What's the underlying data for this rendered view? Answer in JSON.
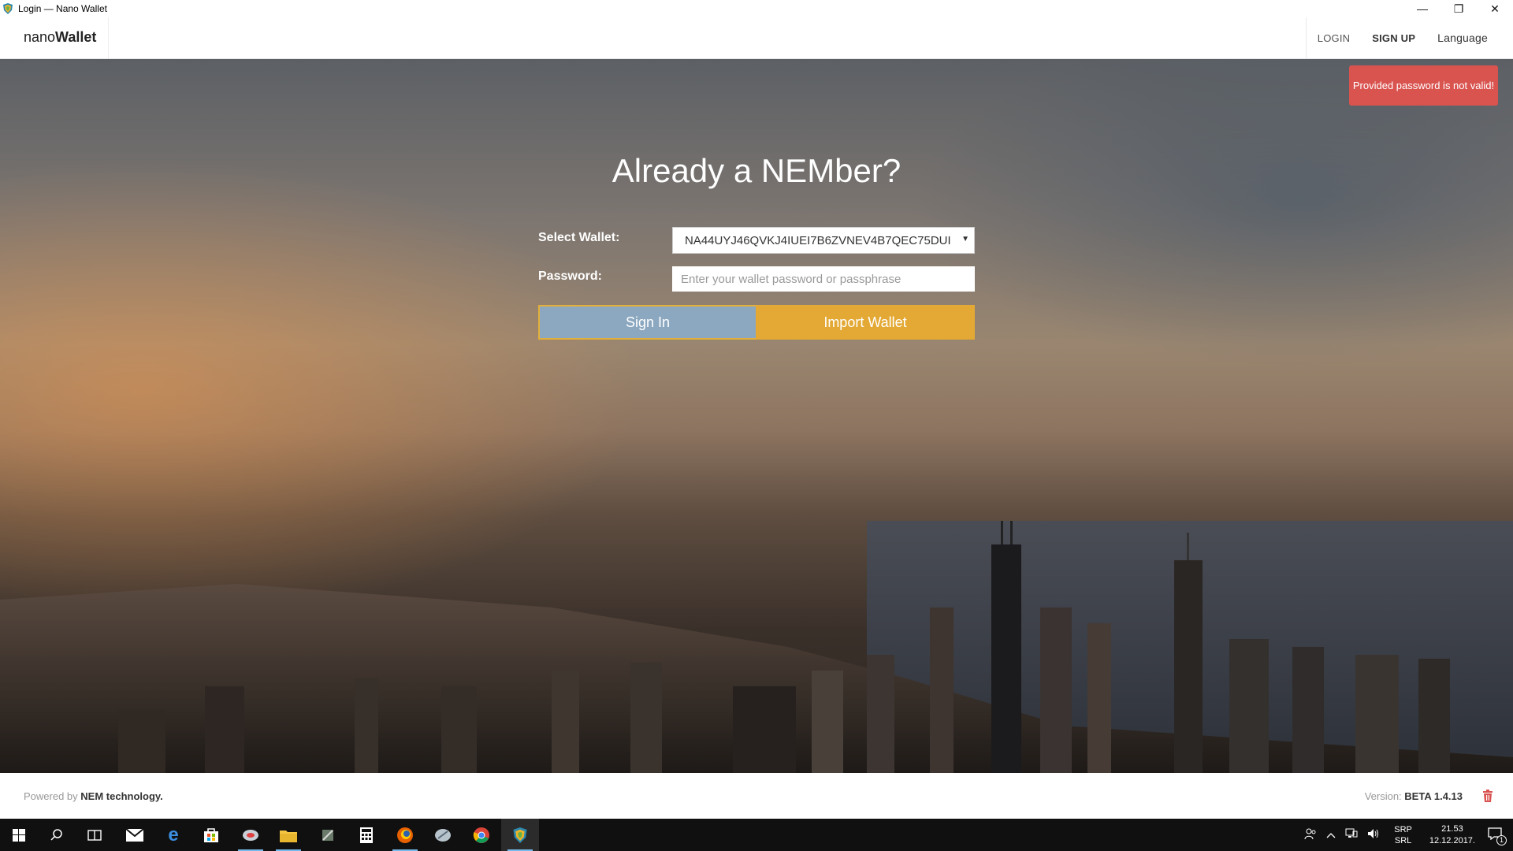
{
  "window": {
    "title": "Login — Nano Wallet",
    "minimize": "—",
    "restore": "❐",
    "close": "✕"
  },
  "navbar": {
    "logo_nano": "nano",
    "logo_wallet": "Wallet",
    "links": {
      "login": "LOGIN",
      "signup": "SIGN UP",
      "language": "Language"
    }
  },
  "alert": {
    "message": "Provided password is not valid!",
    "color": "#d9534f"
  },
  "login": {
    "title": "Already a NEMber?",
    "select_wallet_label": "Select Wallet:",
    "selected_wallet": "NA44UYJ46QVKJ4IUEI7B6ZVNEV4B7QEC75DUI",
    "password_label": "Password:",
    "password_value": "",
    "password_placeholder": "Enter your wallet password or passphrase",
    "sign_in": "Sign In",
    "import_wallet": "Import Wallet",
    "sign_in_color": "#8ba8c0",
    "import_color": "#e3a934"
  },
  "footer": {
    "powered_prefix": "Powered by",
    "powered_brand": "NEM technology.",
    "version_label": "Version:",
    "version_value": "BETA 1.4.13",
    "trash_icon": "trash-icon"
  },
  "taskbar": {
    "apps": [
      "windows-start-icon",
      "search-icon",
      "task-view-icon",
      "mail-icon",
      "edge-icon",
      "store-icon",
      "app-icon",
      "file-explorer-icon",
      "app-icon",
      "calculator-icon",
      "firefox-icon",
      "app-icon",
      "chrome-icon",
      "nem-wallet-icon"
    ],
    "lang_line1": "SRP",
    "lang_line2": "SRL",
    "time": "21.53",
    "date": "12.12.2017.",
    "notification_count": "1"
  }
}
